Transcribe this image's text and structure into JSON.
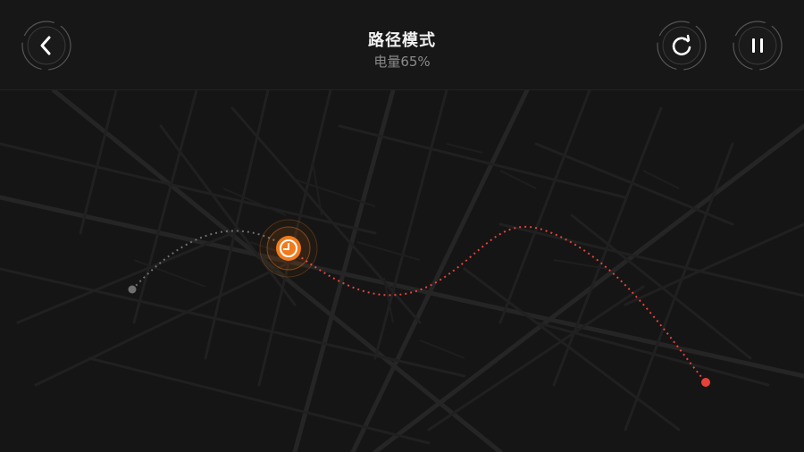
{
  "header": {
    "title": "路径模式",
    "battery_text": "电量65%"
  },
  "buttons": {
    "back_icon": "chevron-left-icon",
    "refresh_icon": "refresh-icon",
    "pause_icon": "pause-icon"
  },
  "colors": {
    "background": "#151515",
    "route_active": "#e8413a",
    "route_done": "#7a7a7a",
    "marker": "#f07a1c",
    "map_roads": "#262626"
  }
}
